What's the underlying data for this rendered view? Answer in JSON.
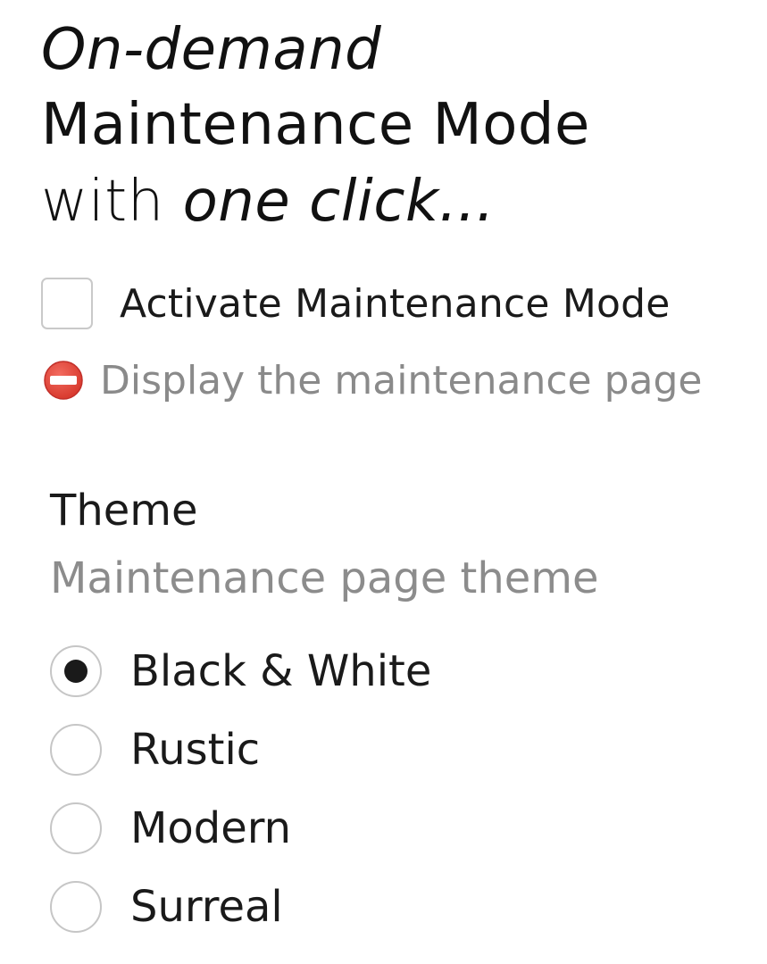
{
  "hero": {
    "line1": "On-demand",
    "line2": "Maintenance Mode",
    "line3_prefix": "with ",
    "line3_emphasis": "one click..."
  },
  "activate": {
    "label": "Activate Maintenance Mode",
    "checked": false
  },
  "status": {
    "icon": "no-entry-icon",
    "icon_color": "#e8463a",
    "text": "Display the maintenance page"
  },
  "theme": {
    "title": "Theme",
    "description": "Maintenance page theme",
    "selected": "Black & White",
    "options": [
      {
        "label": "Black & White",
        "checked": true
      },
      {
        "label": "Rustic",
        "checked": false
      },
      {
        "label": "Modern",
        "checked": false
      },
      {
        "label": "Surreal",
        "checked": false
      }
    ]
  }
}
